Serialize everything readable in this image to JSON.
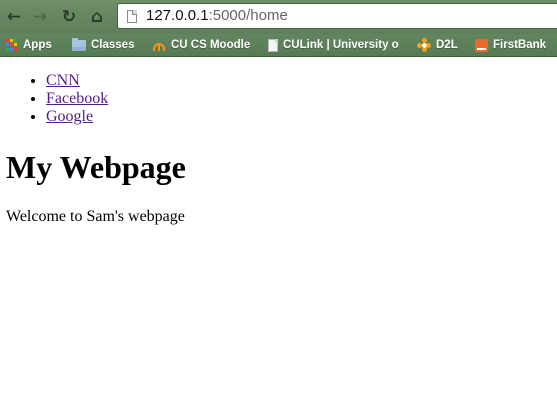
{
  "toolbar": {
    "back_icon": "back-arrow-icon",
    "forward_icon": "forward-arrow-icon",
    "reload_icon": "reload-icon",
    "home_icon": "home-icon",
    "back_glyph": "←",
    "forward_glyph": "→",
    "reload_glyph": "↻",
    "home_glyph": "⌂"
  },
  "address_bar": {
    "host": "127.0.0.1",
    "rest": ":5000/home"
  },
  "bookmarks": [
    {
      "label": "Apps",
      "icon": "apps-grid-icon"
    },
    {
      "label": "Classes",
      "icon": "folder-icon"
    },
    {
      "label": "CU CS Moodle",
      "icon": "moodle-icon"
    },
    {
      "label": "CULink | University o",
      "icon": "page-icon"
    },
    {
      "label": "D2L",
      "icon": "d2l-icon"
    },
    {
      "label": "FirstBank",
      "icon": "firstbank-icon"
    }
  ],
  "page": {
    "links": [
      "CNN",
      "Facebook",
      "Google"
    ],
    "heading": "My Webpage",
    "welcome": "Welcome to Sam's webpage"
  },
  "colors": {
    "chrome": "#5f7f5a",
    "link": "#551a8b"
  }
}
